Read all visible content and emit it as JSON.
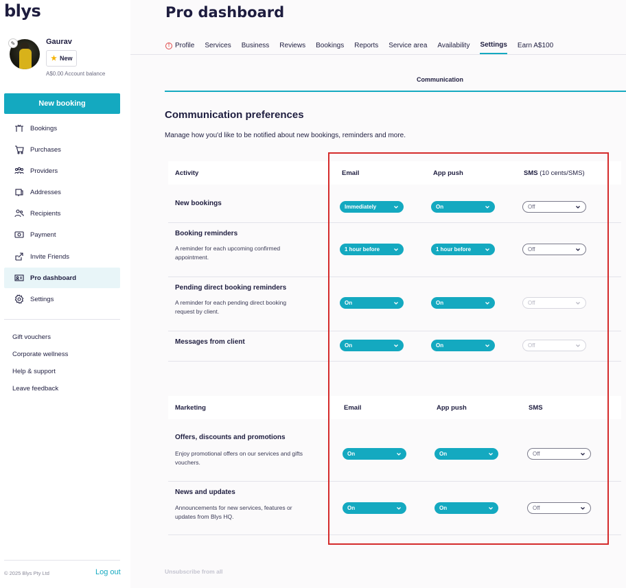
{
  "brand": {
    "logo": "blys"
  },
  "user": {
    "name": "Gaurav",
    "badge": "New",
    "balance": "A$0.00 Account balance"
  },
  "sidebar": {
    "new_booking": "New booking",
    "items": [
      {
        "label": "Bookings",
        "icon": "bookings-icon"
      },
      {
        "label": "Purchases",
        "icon": "purchases-icon"
      },
      {
        "label": "Providers",
        "icon": "providers-icon"
      },
      {
        "label": "Addresses",
        "icon": "addresses-icon"
      },
      {
        "label": "Recipients",
        "icon": "recipients-icon"
      },
      {
        "label": "Payment",
        "icon": "payment-icon"
      },
      {
        "label": "Invite Friends",
        "icon": "invite-icon"
      },
      {
        "label": "Pro dashboard",
        "icon": "pro-dashboard-icon",
        "active": true
      },
      {
        "label": "Settings",
        "icon": "settings-icon"
      }
    ],
    "links": [
      "Gift vouchers",
      "Corporate wellness",
      "Help & support",
      "Leave feedback"
    ],
    "copyright": "© 2025 Blys Pty Ltd",
    "logout": "Log out"
  },
  "main": {
    "title": "Pro dashboard",
    "tabs": [
      "Profile",
      "Services",
      "Business",
      "Reviews",
      "Bookings",
      "Reports",
      "Service area",
      "Availability",
      "Settings",
      "Earn A$100"
    ],
    "active_tab": "Settings",
    "subtab": "Communication",
    "section_title": "Communication preferences",
    "section_desc": "Manage how you'd like to be notified about new bookings, reminders and more.",
    "activity": {
      "header": {
        "col1": "Activity",
        "email": "Email",
        "push": "App push",
        "sms": "SMS",
        "sms_note": "(10 cents/SMS)"
      },
      "rows": [
        {
          "title": "New bookings",
          "desc": "",
          "email": "Immediately",
          "push": "On",
          "sms": "Off"
        },
        {
          "title": "Booking reminders",
          "desc": "A reminder for each upcoming confirmed appointment.",
          "email": "1 hour before",
          "push": "1 hour before",
          "sms": "Off"
        },
        {
          "title": "Pending direct booking reminders",
          "desc": "A reminder for each pending direct booking request by client.",
          "email": "On",
          "push": "On",
          "sms": "Off"
        },
        {
          "title": "Messages from client",
          "desc": "",
          "email": "On",
          "push": "On",
          "sms": "Off"
        }
      ]
    },
    "marketing": {
      "header": {
        "col1": "Marketing",
        "email": "Email",
        "push": "App push",
        "sms": "SMS"
      },
      "rows": [
        {
          "title": "Offers, discounts and promotions",
          "desc": "Enjoy promotional offers on our services and gifts vouchers.",
          "email": "On",
          "push": "On",
          "sms": "Off"
        },
        {
          "title": "News and updates",
          "desc": "Announcements for new services, features or updates from Blys HQ.",
          "email": "On",
          "push": "On",
          "sms": "Off"
        }
      ]
    },
    "unsubscribe": "Unsubscribe from all"
  },
  "colors": {
    "accent": "#14a9c0",
    "text": "#1e1d3f",
    "highlight": "#d42a2a"
  }
}
